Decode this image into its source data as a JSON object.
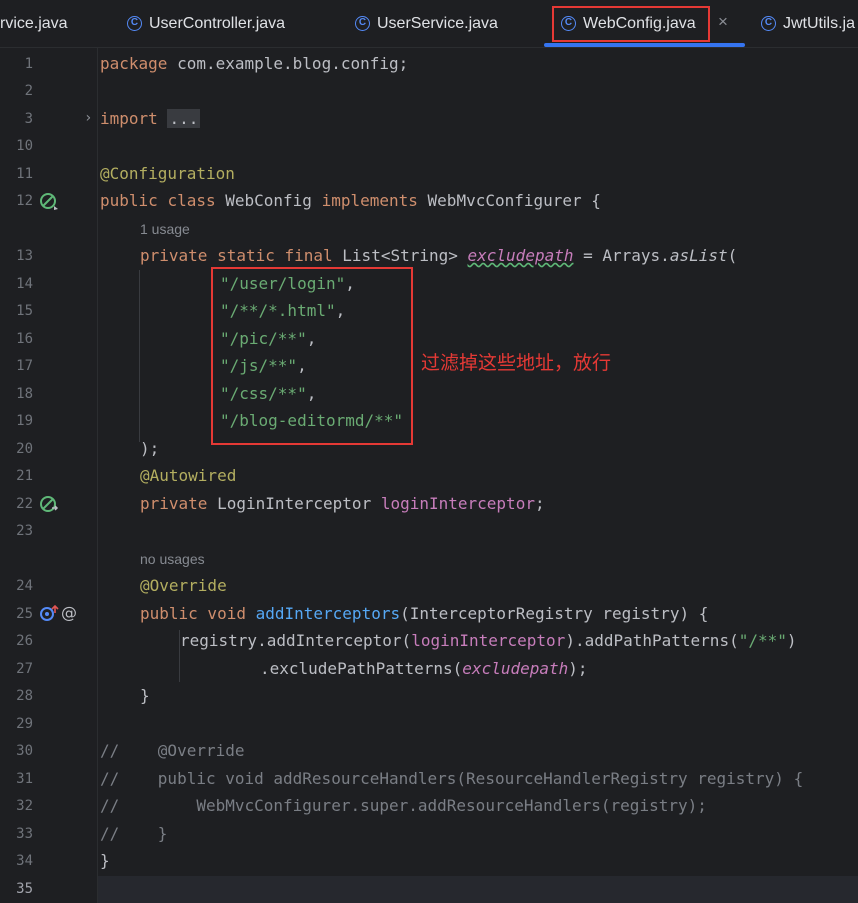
{
  "tabs": [
    {
      "label": "rvice.java",
      "icon": "java-class-icon"
    },
    {
      "label": "UserController.java",
      "icon": "java-class-icon"
    },
    {
      "label": "UserService.java",
      "icon": "java-class-icon"
    },
    {
      "label": "WebConfig.java",
      "icon": "java-class-icon",
      "active": true
    },
    {
      "label": "JwtUtils.ja",
      "icon": "java-class-icon"
    }
  ],
  "tab_close_glyph": "×",
  "line_numbers": [
    "1",
    "2",
    "3",
    "10",
    "11",
    "12",
    "13",
    "14",
    "15",
    "16",
    "17",
    "18",
    "19",
    "20",
    "21",
    "22",
    "23",
    "24",
    "25",
    "26",
    "27",
    "28",
    "29",
    "30",
    "31",
    "32",
    "33",
    "34",
    "35"
  ],
  "hints": {
    "usage_1": "1 usage",
    "usage_2": "no usages"
  },
  "code": {
    "l1_kw": "package",
    "l1_rest": " com.example.blog.config;",
    "l3_kw": "import",
    "l3_fold": "...",
    "l11": "@Configuration",
    "l12_kw1": "public",
    "l12_kw2": "class",
    "l12_name": " WebConfig ",
    "l12_kw3": "implements",
    "l12_rest": " WebMvcConfigurer {",
    "l13_kw": "private static final",
    "l13_type": " List<String> ",
    "l13_field": "excludepath",
    "l13_eq": " = Arrays.",
    "l13_call": "asList",
    "l13_paren": "(",
    "l14": "\"/user/login\"",
    "l15": "\"/**/*.html\"",
    "l16": "\"/pic/**\"",
    "l17": "\"/js/**\"",
    "l18": "\"/css/**\"",
    "l19": "\"/blog-editormd/**\"",
    "comma": ",",
    "l20": ");",
    "l21": "@Autowired",
    "l22_kw": "private",
    "l22_type": " LoginInterceptor ",
    "l22_field": "loginInterceptor",
    "l22_end": ";",
    "l24": "@Override",
    "l25_kw": "public void",
    "l25_method": " addInterceptors",
    "l25_rest": "(InterceptorRegistry registry) {",
    "l26_a": "registry.addInterceptor(",
    "l26_field": "loginInterceptor",
    "l26_b": ").addPathPatterns(",
    "l26_str": "\"/**\"",
    "l26_c": ")",
    "l27_a": ".excludePathPatterns(",
    "l27_field": "excludepath",
    "l27_b": ");",
    "l28": "}",
    "l30": "//    @Override",
    "l31": "//    public void addResourceHandlers(ResourceHandlerRegistry registry) {",
    "l32": "//        WebMvcConfigurer.super.addResourceHandlers(registry);",
    "l33": "//    }",
    "l34": "}"
  },
  "annotation_note": "过滤掉这些地址，放行",
  "colors": {
    "background": "#1e1f22",
    "keyword": "#cf8e6d",
    "annotation": "#b3ae60",
    "string": "#6aab73",
    "field": "#c77dbb",
    "method": "#56a8f5",
    "comment": "#7a7e85",
    "highlight_red": "#e53935",
    "tab_active": "#3574f0"
  }
}
